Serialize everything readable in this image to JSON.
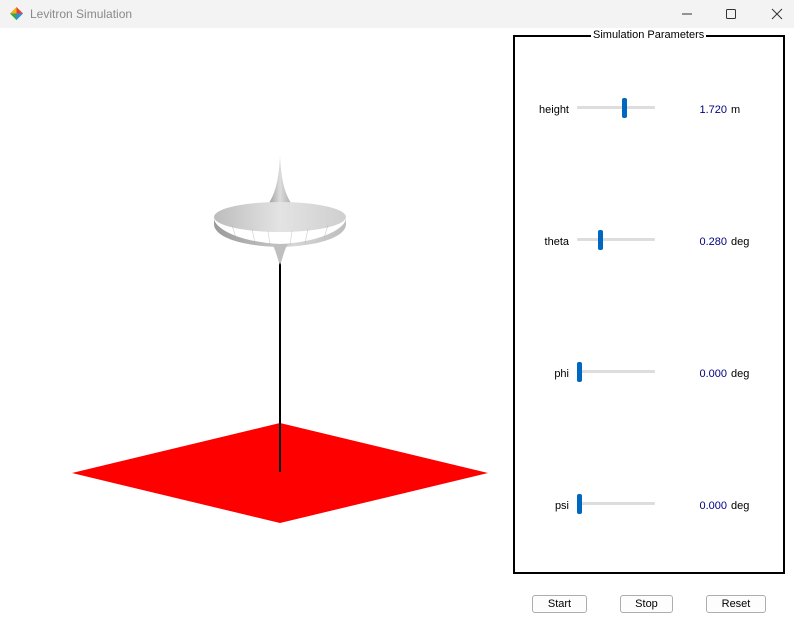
{
  "window": {
    "title": "Levitron Simulation"
  },
  "panel": {
    "title": "Simulation Parameters",
    "params": [
      {
        "label": "height",
        "value": "1.720",
        "unit": "m",
        "slider_fraction": 0.6
      },
      {
        "label": "theta",
        "value": "0.280",
        "unit": "deg",
        "slider_fraction": 0.28
      },
      {
        "label": "phi",
        "value": "0.000",
        "unit": "deg",
        "slider_fraction": 0.0
      },
      {
        "label": "psi",
        "value": "0.000",
        "unit": "deg",
        "slider_fraction": 0.0
      }
    ]
  },
  "buttons": {
    "start": "Start",
    "stop": "Stop",
    "reset": "Reset"
  },
  "colors": {
    "ground": "#ff0000",
    "slider_thumb": "#0067c0",
    "value_text": "#000080"
  }
}
